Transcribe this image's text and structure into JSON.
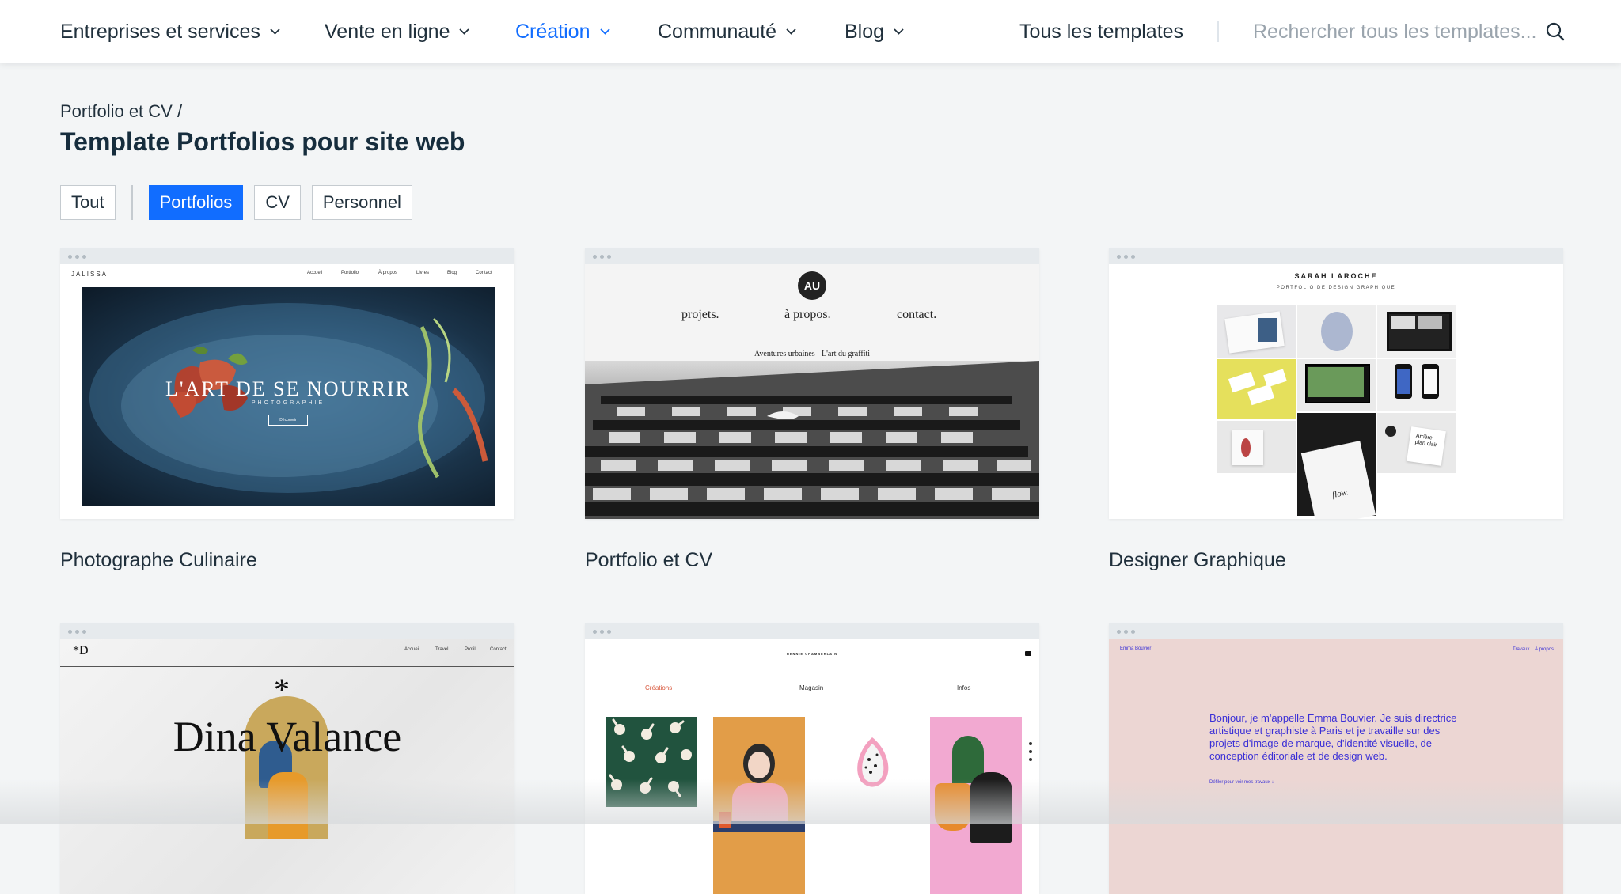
{
  "nav": {
    "items": [
      {
        "label": "Entreprises et services"
      },
      {
        "label": "Vente en ligne"
      },
      {
        "label": "Création"
      },
      {
        "label": "Communauté"
      },
      {
        "label": "Blog"
      }
    ],
    "all_templates": "Tous les templates",
    "search_placeholder": "Rechercher tous les templates...",
    "active_color": "#116dff"
  },
  "header": {
    "breadcrumb": "Portfolio et CV /",
    "title": "Template Portfolios pour site web"
  },
  "filters": {
    "items": [
      {
        "label": "Tout",
        "selected": false
      },
      {
        "label": "Portfolios",
        "selected": true
      },
      {
        "label": "CV",
        "selected": false
      },
      {
        "label": "Personnel",
        "selected": false
      }
    ]
  },
  "templates": [
    {
      "title": "Photographe Culinaire",
      "preview": {
        "brand": "JALISSA",
        "menu": [
          "Accueil",
          "Portfolio",
          "À propos",
          "Livres",
          "Blog",
          "Contact"
        ],
        "headline": "L'ART DE SE NOURRIR",
        "subheadline": "PHOTOGRAPHIE",
        "button": "Découvrir"
      }
    },
    {
      "title": "Portfolio et CV",
      "preview": {
        "logo": "AU",
        "menu": [
          "projets.",
          "à propos.",
          "contact."
        ],
        "caption": "Aventures urbaines - L'art du graffiti"
      }
    },
    {
      "title": "Designer Graphique",
      "preview": {
        "name": "SARAH LAROCHE",
        "subtitle": "PORTFOLIO DE DESIGN GRAPHIQUE",
        "tile_text": "Arrière plan clair"
      }
    },
    {
      "title": "",
      "preview": {
        "brand": "*D",
        "menu": [
          "Accueil",
          "Travel",
          "Profil",
          "Contact"
        ],
        "headline": "Dina Valance"
      }
    },
    {
      "title": "",
      "preview": {
        "brand": "RENNIE CHAMBERLAIN",
        "menu": [
          "Créations",
          "Magasin",
          "Infos"
        ]
      }
    },
    {
      "title": "",
      "preview": {
        "brand": "Emma Bouvier",
        "menu": [
          "Travaux",
          "À propos"
        ],
        "intro": "Bonjour, je m'appelle Emma Bouvier. Je suis directrice artistique et graphiste à Paris et je travaille sur des projets d'image de marque, d'identité visuelle, de conception éditoriale et de design web.",
        "link": "Défiler pour voir mes travaux ↓"
      }
    }
  ]
}
